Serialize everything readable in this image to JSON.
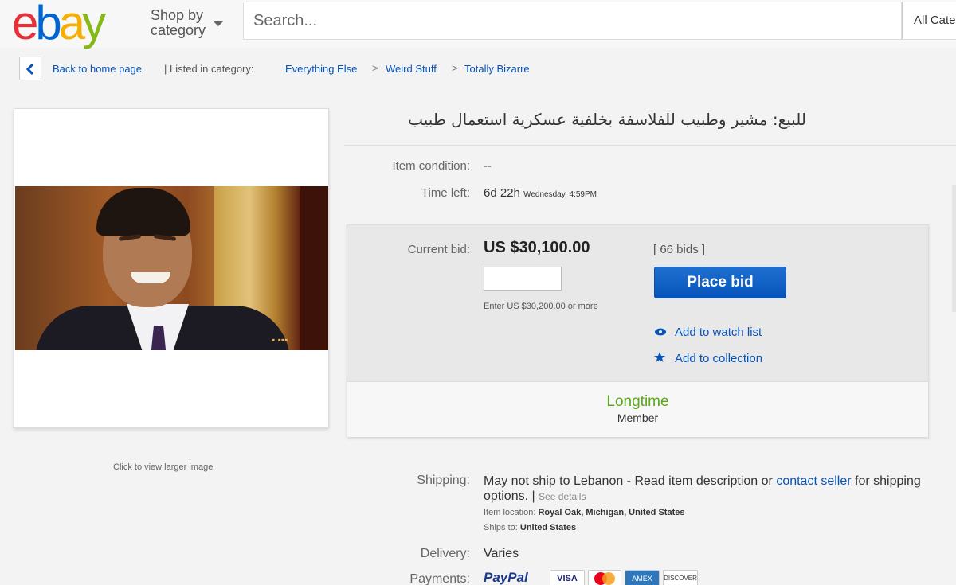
{
  "header": {
    "logo_letters": [
      "e",
      "b",
      "a",
      "y"
    ],
    "shop_by_line1": "Shop by",
    "shop_by_line2": "category",
    "search_placeholder": "Search...",
    "all_categories": "All Categories"
  },
  "breadcrumb": {
    "back": "Back to home page",
    "listed_in": "| Listed in category:",
    "items": [
      "Everything Else",
      "Weird Stuff",
      "Totally Bizarre"
    ],
    "separator": ">"
  },
  "image_panel": {
    "click_larger": "Click to view larger image"
  },
  "listing": {
    "title": "للبيع: مشير وطبيب للفلاسفة بخلفية عسكرية استعمال طبيب",
    "condition_label": "Item condition:",
    "condition_value": "--",
    "time_left_label": "Time left:",
    "time_left_value": "6d 22h",
    "time_left_detail": "Wednesday, 4:59PM"
  },
  "bid": {
    "current_bid_label": "Current bid:",
    "current_bid_value": "US $30,100.00",
    "bid_count": "[ 66 bids ]",
    "enter_hint": "Enter US $30,200.00 or more",
    "place_bid": "Place bid",
    "watch_list": "Add to watch list",
    "collection": "Add to collection",
    "badge_line1": "Longtime",
    "badge_line2": "Member"
  },
  "shipping": {
    "label": "Shipping:",
    "text_before": "May not ship to Lebanon - Read item description or ",
    "contact_seller": "contact seller",
    "text_after": " for shipping options. |",
    "see_details": "See details",
    "item_location_label": "Item location:",
    "item_location_value": "Royal Oak, Michigan, United States",
    "ships_to_label": "Ships to:",
    "ships_to_value": "United States"
  },
  "delivery": {
    "label": "Delivery:",
    "value": "Varies"
  },
  "payments": {
    "label": "Payments:",
    "methods": [
      "PayPal",
      "VISA",
      "MasterCard",
      "AMEX",
      "DISCOVER"
    ]
  },
  "colors": {
    "link": "#0654ba",
    "place_bid": "#0654ba",
    "longtime_green": "#5ba71b"
  }
}
